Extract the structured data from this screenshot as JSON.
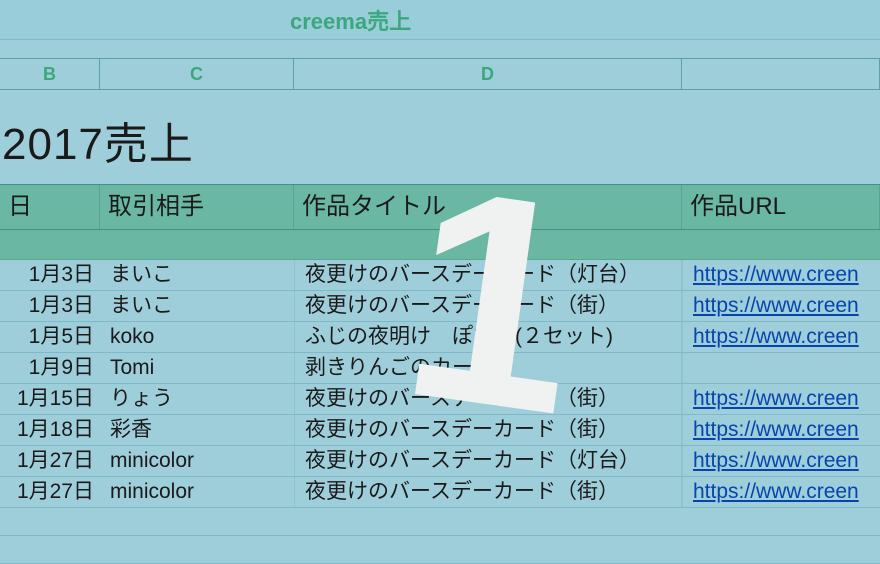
{
  "tab": {
    "label": "creema売上"
  },
  "columns": {
    "b": "B",
    "c": "C",
    "d": "D"
  },
  "title": "2017売上",
  "headers": {
    "date": "日",
    "partner": "取引相手",
    "work_title": "作品タイトル",
    "url": "作品URL"
  },
  "rows": [
    {
      "date": "1月3日",
      "partner": "まいこ",
      "title": "夜更けのバースデーカード（灯台）",
      "url": "https://www.creen"
    },
    {
      "date": "1月3日",
      "partner": "まいこ",
      "title": "夜更けのバースデーカード（街）",
      "url": "https://www.creen"
    },
    {
      "date": "1月5日",
      "partner": "koko",
      "title": "ふじの夜明け　ぽち袋(２セット)",
      "url": "https://www.creen"
    },
    {
      "date": "1月9日",
      "partner": "Tomi",
      "title": "剥きりんごのカード",
      "url": ""
    },
    {
      "date": "1月15日",
      "partner": "りょう",
      "title": "夜更けのバースデーカード（街）",
      "url": "https://www.creen"
    },
    {
      "date": "1月18日",
      "partner": "彩香",
      "title": "夜更けのバースデーカード（街）",
      "url": "https://www.creen"
    },
    {
      "date": "1月27日",
      "partner": "minicolor",
      "title": "夜更けのバースデーカード（灯台）",
      "url": "https://www.creen"
    },
    {
      "date": "1月27日",
      "partner": "minicolor",
      "title": "夜更けのバースデーカード（街）",
      "url": "https://www.creen"
    }
  ],
  "watermark": "1"
}
